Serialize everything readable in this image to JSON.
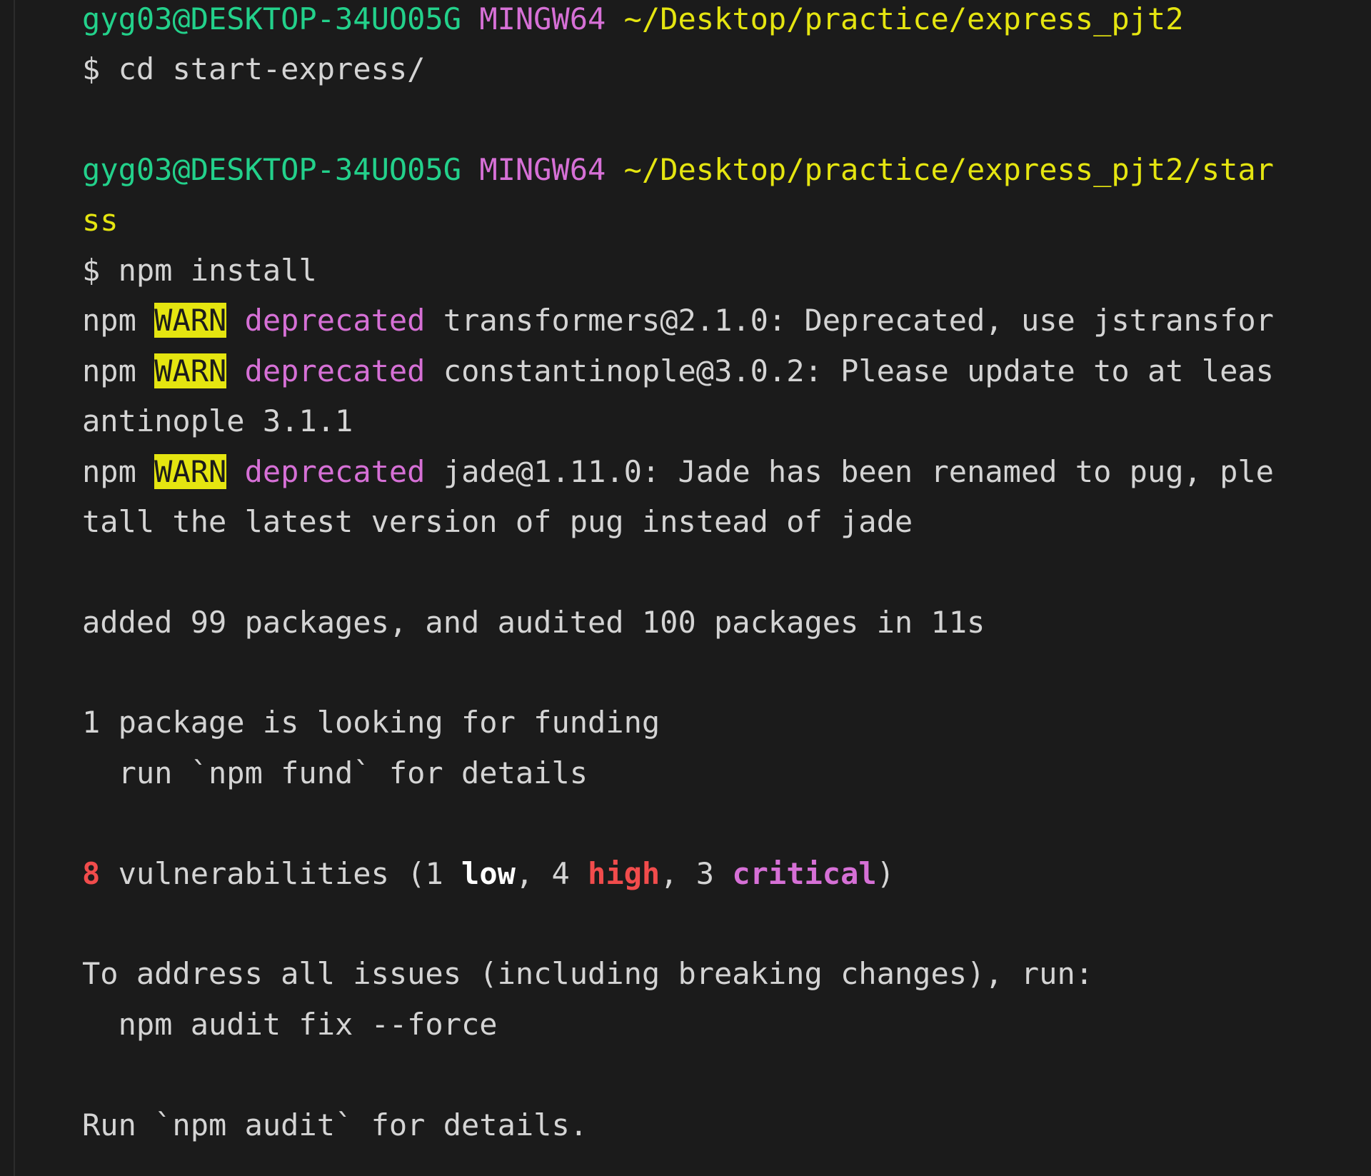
{
  "theme": {
    "background": "#1b1b1b",
    "foreground": "#d4d4d4",
    "user_host": "#23d18b",
    "shell_name": "#d670d6",
    "path": "#e5e510",
    "warn_bg": "#e5e510",
    "deprecated": "#d670d6",
    "error_red": "#f14c4c"
  },
  "prompt1": {
    "user_host": "gyg03@DESKTOP-34UO05G",
    "shell": "MINGW64",
    "path": "~/Desktop/practice/express_pjt2"
  },
  "cmd1": {
    "symbol": "$",
    "text": "cd start-express/"
  },
  "prompt2": {
    "user_host": "gyg03@DESKTOP-34UO05G",
    "shell": "MINGW64",
    "path": "~/Desktop/practice/express_pjt2/star",
    "wrap": "ss"
  },
  "cmd2": {
    "symbol": "$",
    "text": "npm install"
  },
  "warnings": [
    {
      "prefix": "npm",
      "level": "WARN",
      "tag": "deprecated",
      "message": "transformers@2.1.0: Deprecated, use jstransfor",
      "wrap": ""
    },
    {
      "prefix": "npm",
      "level": "WARN",
      "tag": "deprecated",
      "message": "constantinople@3.0.2: Please update to at leas",
      "wrap": "antinople 3.1.1"
    },
    {
      "prefix": "npm",
      "level": "WARN",
      "tag": "deprecated",
      "message": "jade@1.11.0: Jade has been renamed to pug, ple",
      "wrap": "tall the latest version of pug instead of jade"
    }
  ],
  "summary": {
    "added": "added 99 packages, and audited 100 packages in 11s",
    "funding_1": "1 package is looking for funding",
    "funding_2": "  run `npm fund` for details"
  },
  "vulnerabilities": {
    "count": "8",
    "text_a": " vulnerabilities (1 ",
    "low": "low",
    "text_b": ", 4 ",
    "high": "high",
    "text_c": ", 3 ",
    "critical": "critical",
    "text_d": ")"
  },
  "fix": {
    "line_1": "To address all issues (including breaking changes), run:",
    "line_2": "  npm audit fix --force",
    "line_3": "Run `npm audit` for details."
  }
}
